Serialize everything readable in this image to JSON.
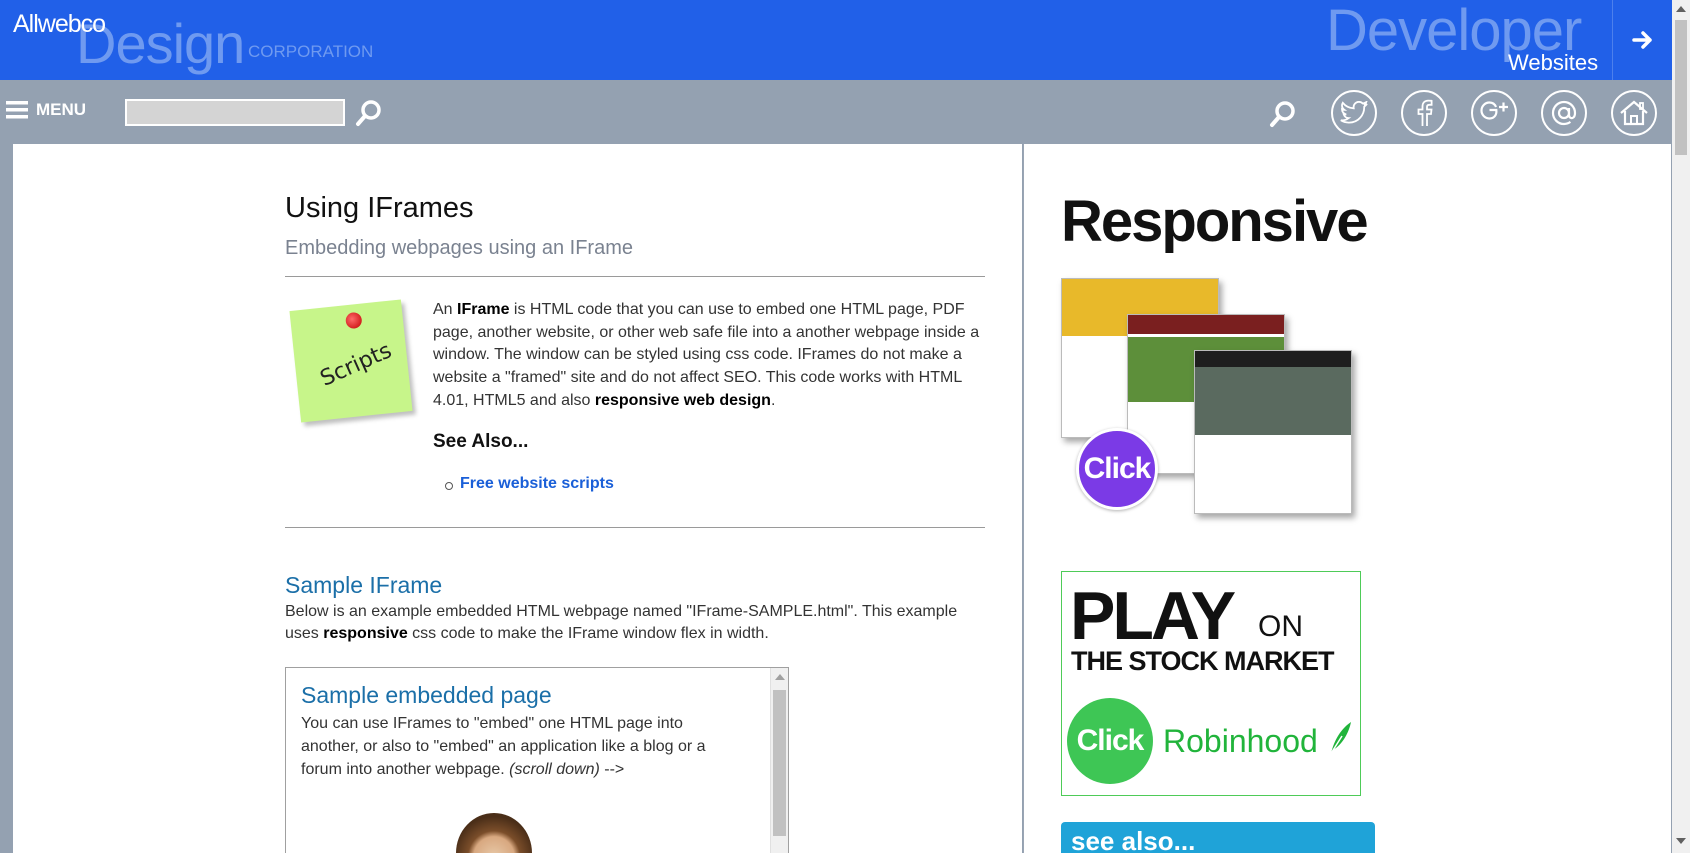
{
  "header": {
    "logo_top": "Allwebco",
    "logo_main": "Design",
    "logo_corp": "CORPORATION",
    "dev_title": "Developer",
    "dev_sub": "Websites"
  },
  "menubar": {
    "menu_label": "MENU",
    "search_placeholder": "",
    "social_icons": [
      "search-icon",
      "twitter-icon",
      "facebook-icon",
      "google-plus-icon",
      "email-icon",
      "home-icon"
    ]
  },
  "main": {
    "title": "Using IFrames",
    "subtitle": "Embedding webpages using an IFrame",
    "note_text": "Scripts",
    "intro": {
      "t1": "An ",
      "b1": "IFrame",
      "t2": " is HTML code that you can use to embed one HTML page, PDF page, another website, or other web safe file into a another webpage inside a window. The window can be styled using css code. IFrames do not make a website a \"framed\" site and do not affect SEO. This code works with HTML 4.01, HTML5 and also ",
      "b2": "responsive web design",
      "t3": "."
    },
    "see_also": "See Also...",
    "see_also_link": "Free website scripts",
    "sample_heading": "Sample IFrame",
    "sample_text": {
      "t1": "Below is an example embedded HTML webpage named \"IFrame-SAMPLE.html\". This example uses ",
      "b1": "responsive",
      "t2": " css code to make the IFrame window flex in width."
    },
    "iframe": {
      "title": "Sample embedded page",
      "text": "You can use IFrames to \"embed\" one HTML page into another, or also to \"embed\" an application like a blog or a forum into another webpage. ",
      "text_italic": "(scroll down)",
      "text_tail": " -->"
    }
  },
  "sidebar": {
    "responsive_title": "Responsive",
    "click_label": "Click",
    "play_word": "PLAY",
    "play_on": "ON",
    "play_sub": "THE STOCK MARKET",
    "robin_click": "Click",
    "robinhood": "Robinhood",
    "see_also_box": "see also..."
  },
  "colors": {
    "header_blue": "#2160e8",
    "menubar_gray": "#94a1b1",
    "heading_blue": "#1b6fa8",
    "link_blue": "#1a5fd8",
    "robinhood_green": "#21b43b"
  }
}
